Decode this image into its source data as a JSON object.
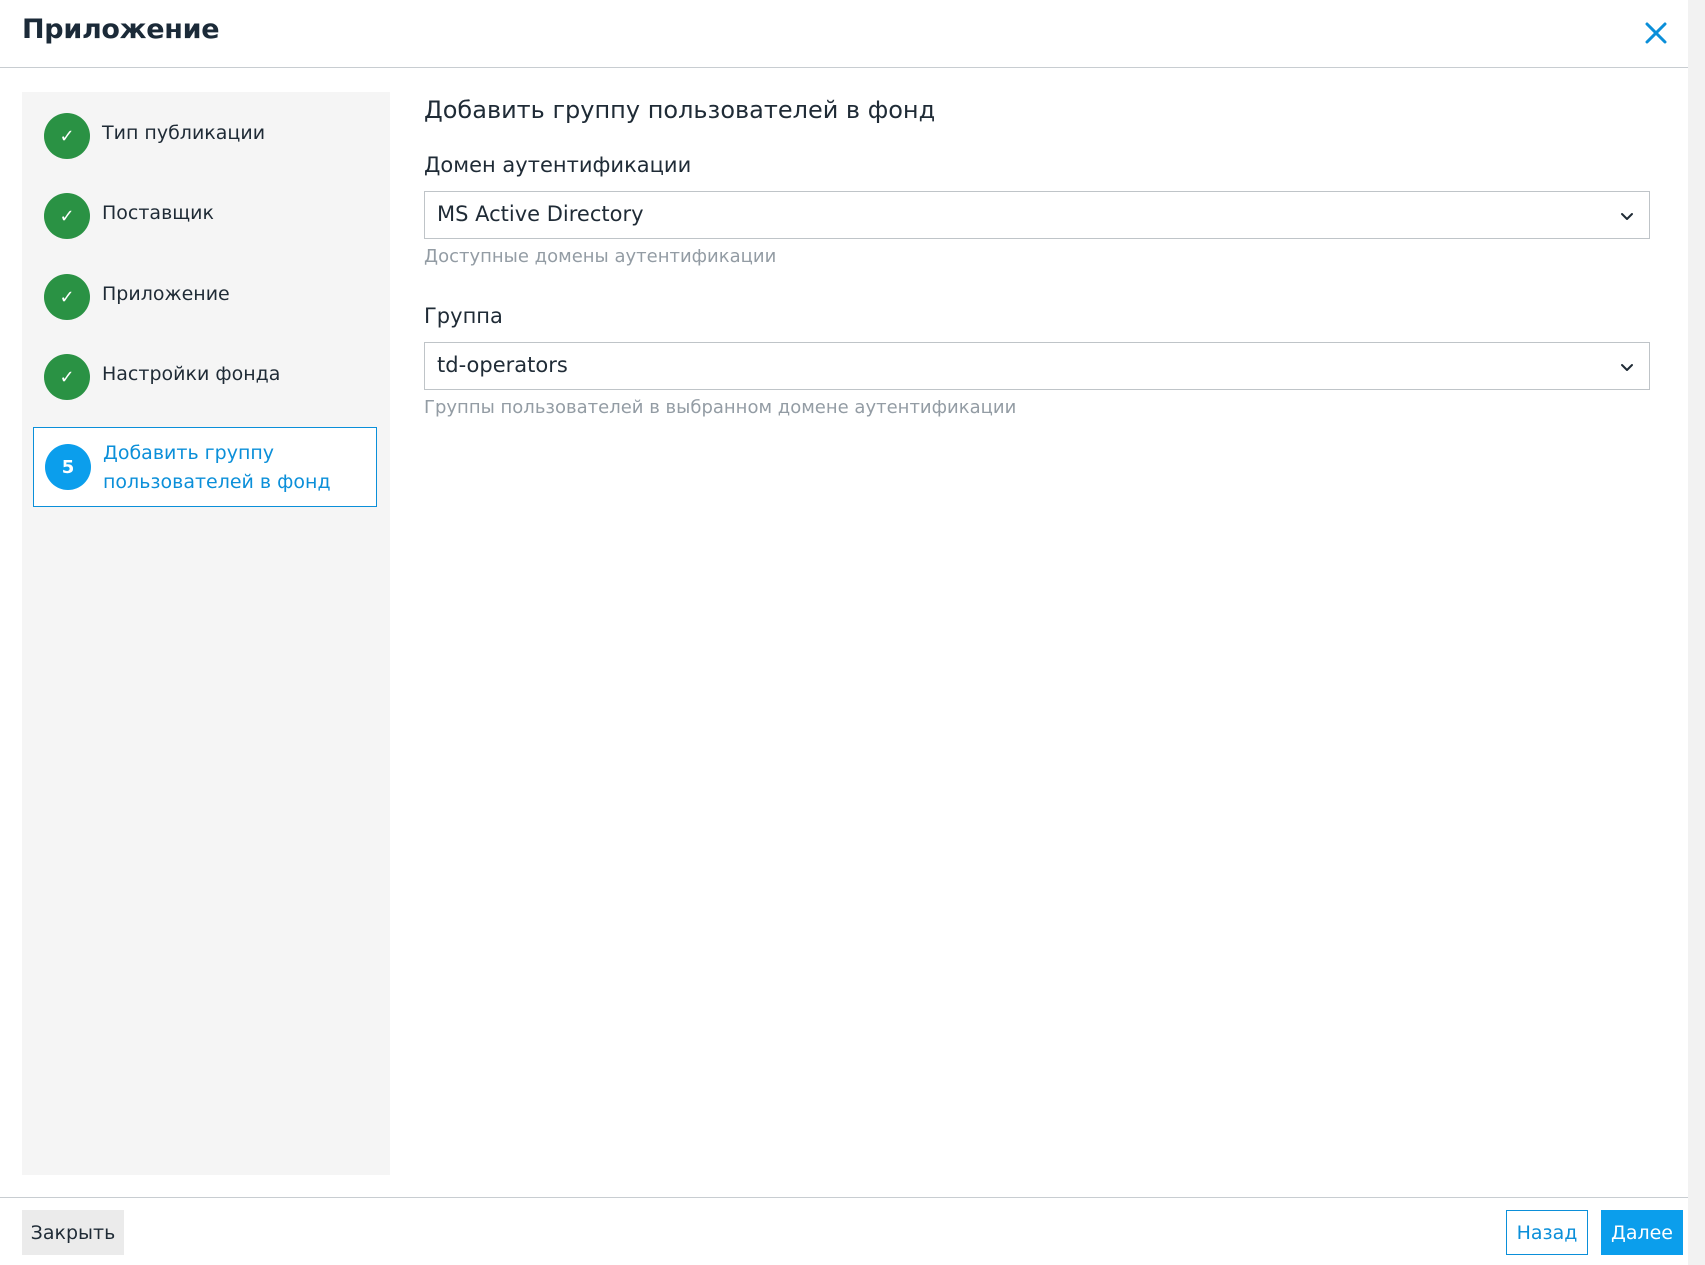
{
  "dialog": {
    "title": "Приложение",
    "close_icon": "close-icon"
  },
  "steps": [
    {
      "label": "Тип публикации",
      "status": "done",
      "mark": "✓"
    },
    {
      "label": "Поставщик",
      "status": "done",
      "mark": "✓"
    },
    {
      "label": "Приложение",
      "status": "done",
      "mark": "✓"
    },
    {
      "label": "Настройки фонда",
      "status": "done",
      "mark": "✓"
    },
    {
      "label": "Добавить группу пользователей в фонд",
      "status": "active",
      "mark": "5"
    }
  ],
  "content": {
    "title": "Добавить группу пользователей в фонд",
    "domain": {
      "label": "Домен аутентификации",
      "value": "MS Active Directory",
      "helper": "Доступные домены аутентификации"
    },
    "group": {
      "label": "Группа",
      "value": "td-operators",
      "helper": "Группы пользователей в выбранном домене аутентификации"
    }
  },
  "footer": {
    "close_label": "Закрыть",
    "back_label": "Назад",
    "next_label": "Далее"
  },
  "colors": {
    "accent": "#0b9eec",
    "done": "#2a9244",
    "sidebar_bg": "#f5f5f5"
  }
}
